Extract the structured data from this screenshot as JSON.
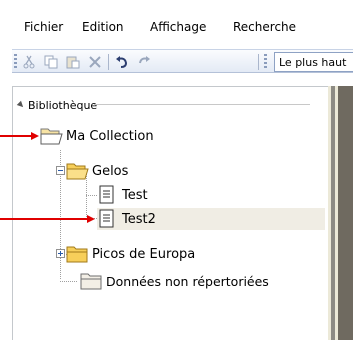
{
  "menubar": {
    "items": [
      "Fichier",
      "Edition",
      "Affichage",
      "Recherche"
    ]
  },
  "toolbar": {
    "buttons": [
      "cut-icon",
      "copy-icon",
      "paste-icon",
      "delete-icon",
      "undo-icon",
      "redo-icon"
    ],
    "sort_combo_value": "Le plus haut"
  },
  "tree": {
    "root_label": "Bibliothèque",
    "items": [
      {
        "label": "Ma Collection",
        "icon": "folder-open-icon"
      },
      {
        "label": "Gelos",
        "icon": "folder-open-icon"
      },
      {
        "label": "Test",
        "icon": "document-icon"
      },
      {
        "label": "Test2",
        "icon": "document-icon",
        "selected": true
      },
      {
        "label": "Picos de Europa",
        "icon": "folder-icon"
      },
      {
        "label": "Données non répertoriées",
        "icon": "folder-icon"
      }
    ]
  },
  "colors": {
    "arrow": "#e00000",
    "folder": "#f7cf5a",
    "selection": "#f0ede4"
  }
}
